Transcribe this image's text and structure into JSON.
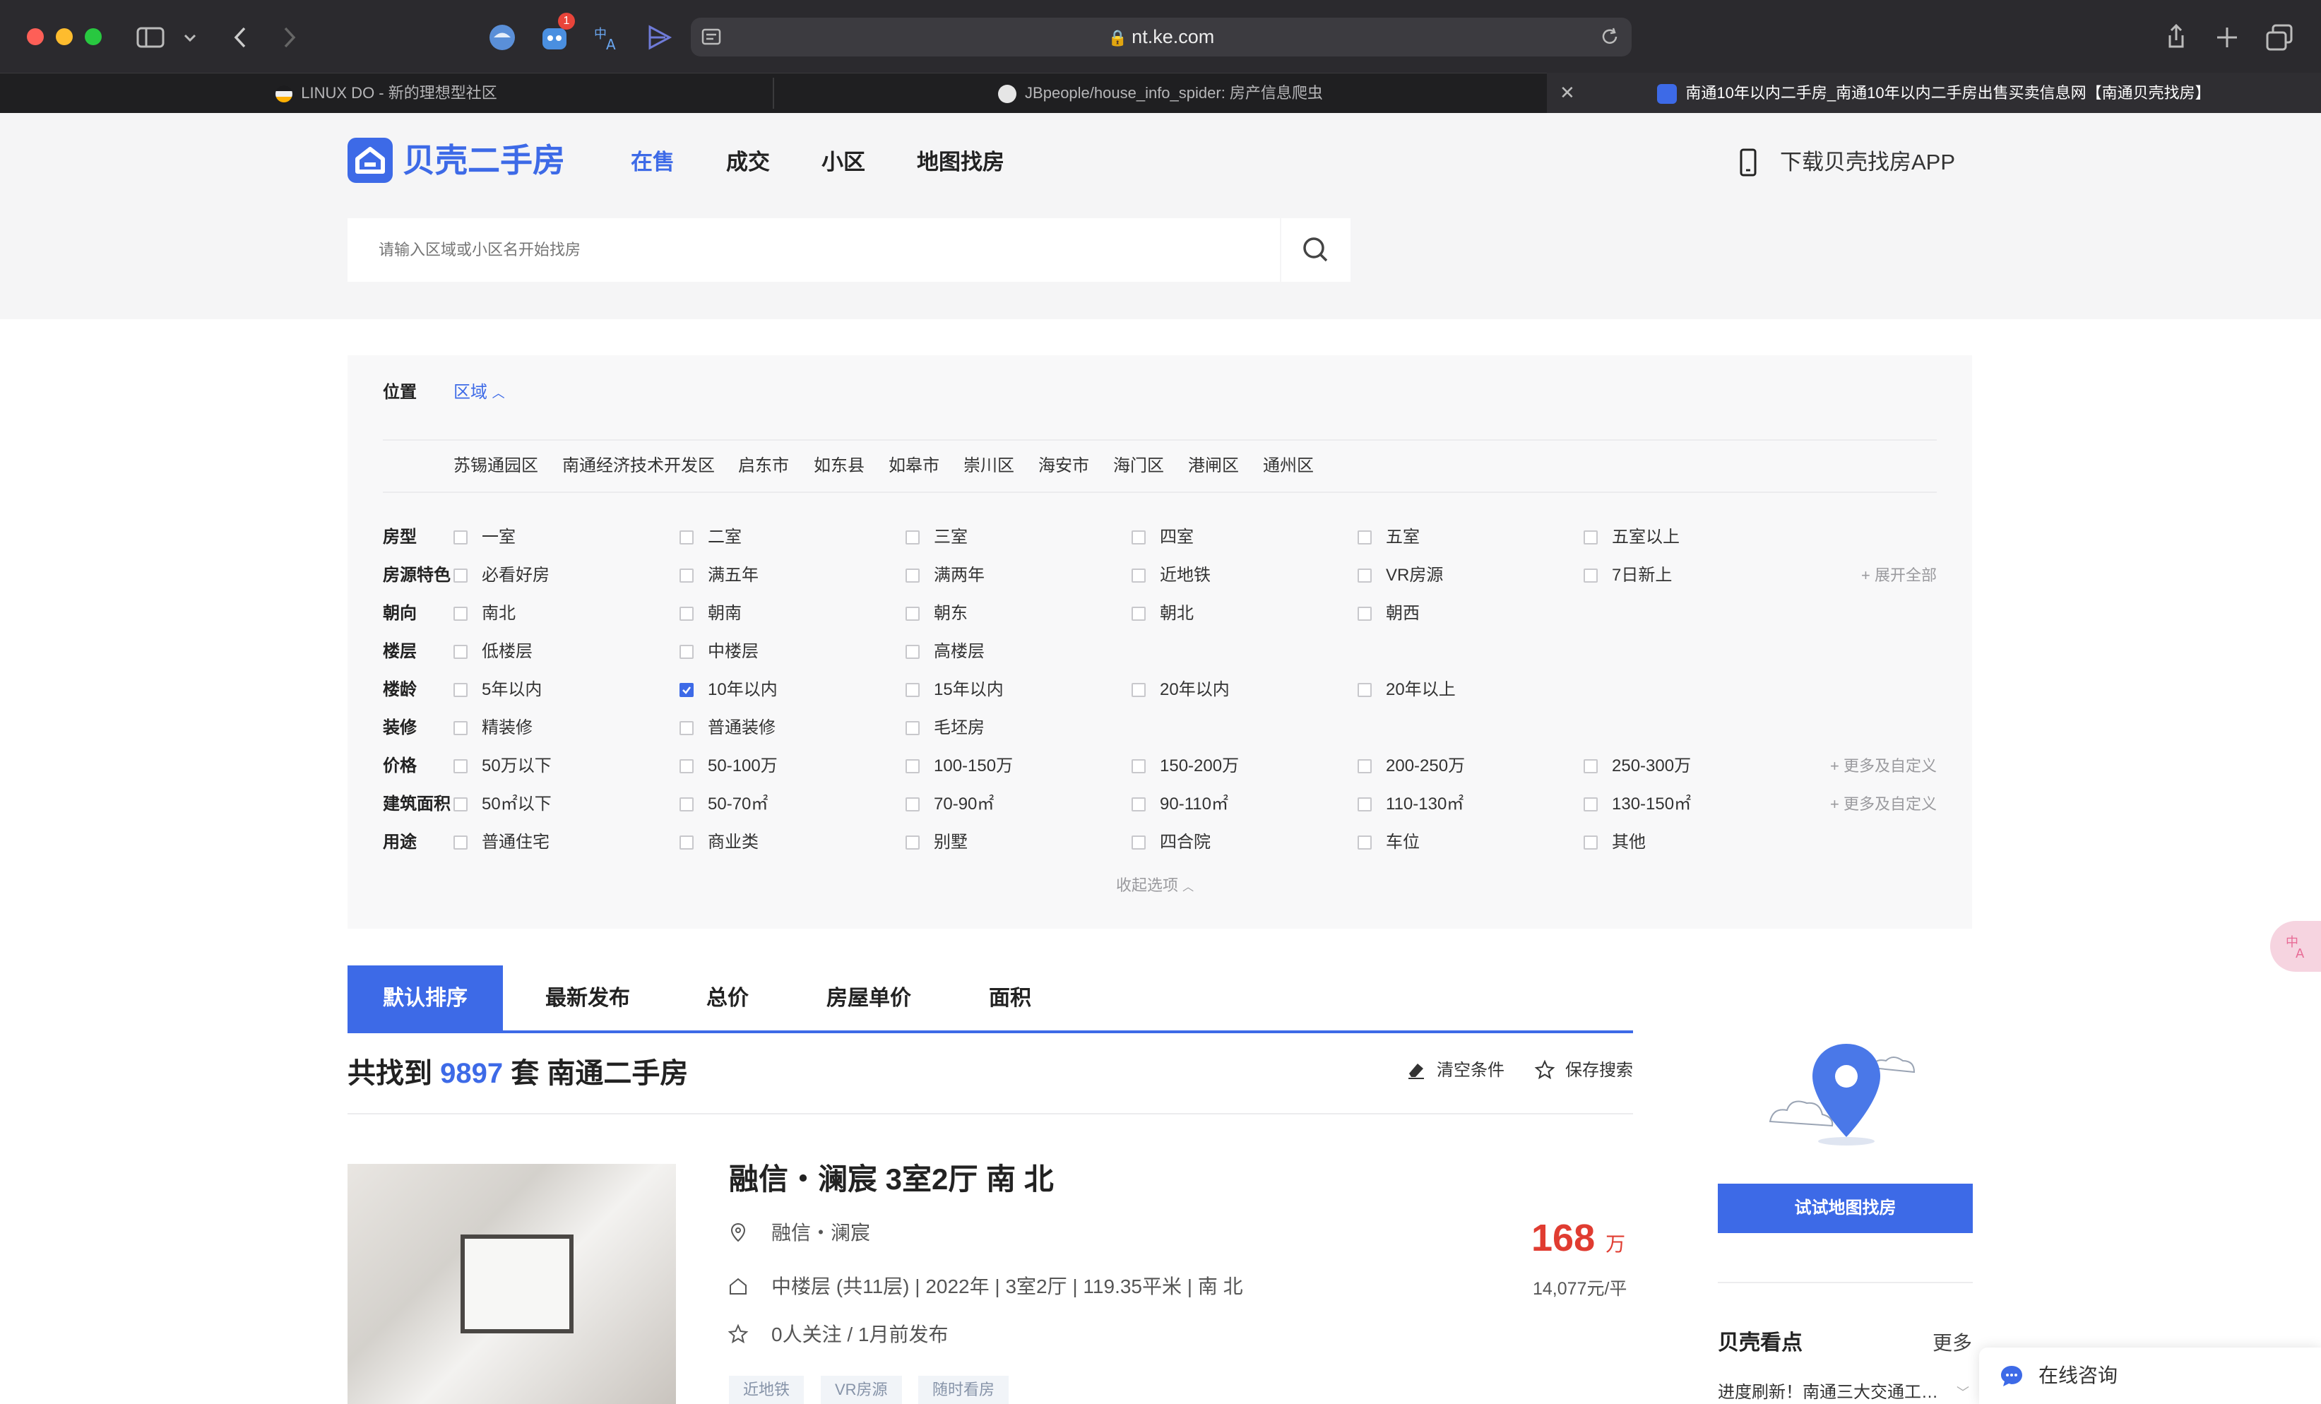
{
  "browser": {
    "url": "nt.ke.com",
    "tabs": [
      {
        "title": "LINUX DO - 新的理想型社区",
        "active": false
      },
      {
        "title": "JBpeople/house_info_spider: 房产信息爬虫",
        "active": false
      },
      {
        "title": "南通10年以内二手房_南通10年以内二手房出售买卖信息网【南通贝壳找房】",
        "active": true
      }
    ],
    "badge_count": "1"
  },
  "header": {
    "logo_text": "贝壳二手房",
    "nav": [
      "在售",
      "成交",
      "小区",
      "地图找房"
    ],
    "active_nav": "在售",
    "download_app": "下载贝壳找房APP",
    "search_placeholder": "请输入区域或小区名开始找房"
  },
  "filters": {
    "location_label": "位置",
    "location_mode": "区域",
    "areas": [
      "苏锡通园区",
      "南通经济技术开发区",
      "启东市",
      "如东县",
      "如皋市",
      "崇川区",
      "海安市",
      "海门区",
      "港闸区",
      "通州区"
    ],
    "rows": [
      {
        "label": "房型",
        "options": [
          "一室",
          "二室",
          "三室",
          "四室",
          "五室",
          "五室以上"
        ]
      },
      {
        "label": "房源特色",
        "options": [
          "必看好房",
          "满五年",
          "满两年",
          "近地铁",
          "VR房源",
          "7日新上"
        ],
        "more": "+ 展开全部"
      },
      {
        "label": "朝向",
        "options": [
          "南北",
          "朝南",
          "朝东",
          "朝北",
          "朝西"
        ]
      },
      {
        "label": "楼层",
        "options": [
          "低楼层",
          "中楼层",
          "高楼层"
        ]
      },
      {
        "label": "楼龄",
        "options": [
          "5年以内",
          "10年以内",
          "15年以内",
          "20年以内",
          "20年以上"
        ],
        "checked": "10年以内"
      },
      {
        "label": "装修",
        "options": [
          "精装修",
          "普通装修",
          "毛坯房"
        ]
      },
      {
        "label": "价格",
        "options": [
          "50万以下",
          "50-100万",
          "100-150万",
          "150-200万",
          "200-250万",
          "250-300万"
        ],
        "more": "+ 更多及自定义"
      },
      {
        "label": "建筑面积",
        "options": [
          "50㎡以下",
          "50-70㎡",
          "70-90㎡",
          "90-110㎡",
          "110-130㎡",
          "130-150㎡"
        ],
        "more": "+ 更多及自定义"
      },
      {
        "label": "用途",
        "options": [
          "普通住宅",
          "商业类",
          "别墅",
          "四合院",
          "车位",
          "其他"
        ]
      }
    ],
    "collapse": "收起选项"
  },
  "sort": {
    "tabs": [
      "默认排序",
      "最新发布",
      "总价",
      "房屋单价",
      "面积"
    ],
    "active": "默认排序"
  },
  "results": {
    "prefix": "共找到",
    "count": "9897",
    "suffix": "套 南通二手房",
    "clear": "清空条件",
    "save": "保存搜索"
  },
  "listing": {
    "title": "融信・澜宸 3室2厅 南 北",
    "community": "融信・澜宸",
    "info": "中楼层 (共11层) | 2022年 | 3室2厅 | 119.35平米 | 南 北",
    "follow": "0人关注 / 1月前发布",
    "price": "168",
    "price_unit": "万",
    "unit_price": "14,077元/平",
    "tags": [
      "近地铁",
      "VR房源",
      "随时看房"
    ]
  },
  "sidebar": {
    "map_button": "试试地图找房",
    "highlights_title": "贝壳看点",
    "highlights_more": "更多",
    "news": "进度刷新！南通三大交通工…",
    "consult": "在线咨询"
  },
  "colors": {
    "brand": "#3d6ae7",
    "price": "#e03c31"
  }
}
